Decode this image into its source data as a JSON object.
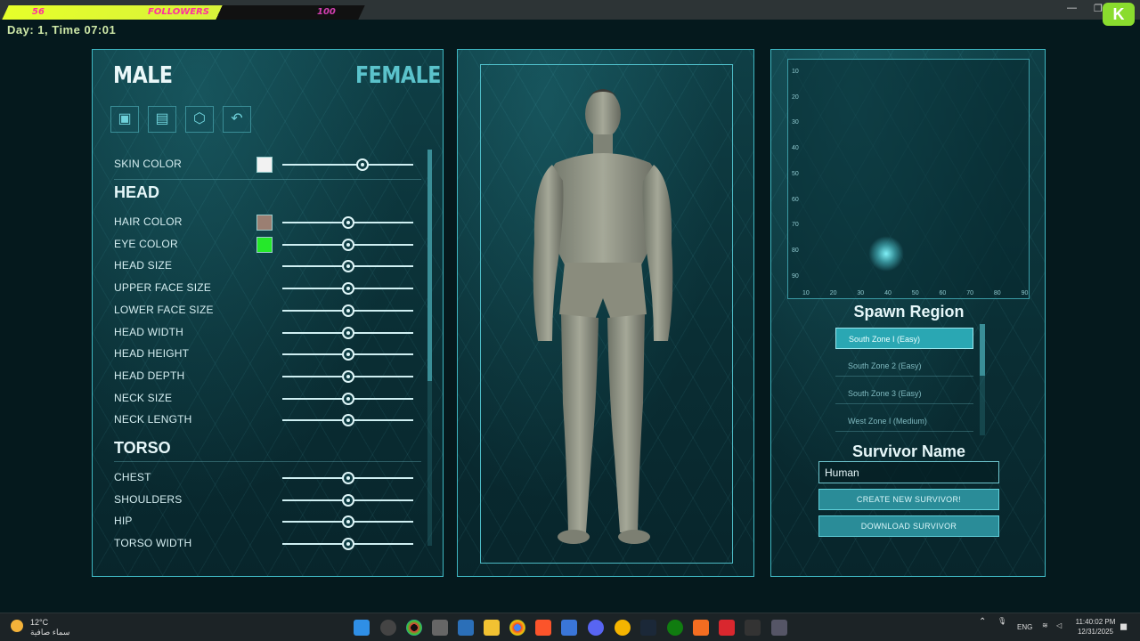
{
  "overlay": {
    "count_left": "56",
    "label": "FOLLOWERS",
    "count_right": "100"
  },
  "hud": {
    "day_time": "Day:  1,  Time  07:01"
  },
  "gender": {
    "male": "MALE",
    "female": "FEMALE"
  },
  "toolbar": {
    "icons": [
      "save-icon",
      "load-icon",
      "randomize-icon",
      "undo-icon"
    ]
  },
  "appearance": {
    "skin_color": {
      "label": "SKIN COLOR",
      "swatch": "#f2f2f2",
      "value": 0.61
    },
    "head_section": "HEAD",
    "head_rows": [
      {
        "label": "HAIR COLOR",
        "swatch": "#9b7f72",
        "value": 0.5
      },
      {
        "label": "EYE COLOR",
        "swatch": "#25e82a",
        "value": 0.5
      },
      {
        "label": "HEAD SIZE",
        "value": 0.5
      },
      {
        "label": "UPPER FACE SIZE",
        "value": 0.5
      },
      {
        "label": "LOWER FACE SIZE",
        "value": 0.5
      },
      {
        "label": "HEAD WIDTH",
        "value": 0.5
      },
      {
        "label": "HEAD HEIGHT",
        "value": 0.5
      },
      {
        "label": "HEAD DEPTH",
        "value": 0.5
      },
      {
        "label": "NECK SIZE",
        "value": 0.5
      },
      {
        "label": "NECK LENGTH",
        "value": 0.5
      }
    ],
    "torso_section": "TORSO",
    "torso_rows": [
      {
        "label": "CHEST",
        "value": 0.5
      },
      {
        "label": "SHOULDERS",
        "value": 0.5
      },
      {
        "label": "HIP",
        "value": 0.5
      },
      {
        "label": "TORSO WIDTH",
        "value": 0.5
      }
    ]
  },
  "map": {
    "y_ticks": [
      "10",
      "20",
      "30",
      "40",
      "50",
      "60",
      "70",
      "80",
      "90"
    ],
    "x_ticks": [
      "10",
      "20",
      "30",
      "40",
      "50",
      "60",
      "70",
      "80",
      "90"
    ]
  },
  "spawn": {
    "title": "Spawn Region",
    "regions": [
      {
        "label": "South Zone I (Easy)",
        "selected": true
      },
      {
        "label": "South Zone 2 (Easy)",
        "selected": false
      },
      {
        "label": "South Zone 3 (Easy)",
        "selected": false
      },
      {
        "label": "West Zone I (Medium)",
        "selected": false
      }
    ]
  },
  "survivor": {
    "title": "Survivor Name",
    "name_value": "Human",
    "create_label": "CREATE NEW SURVIVOR!",
    "download_label": "DOWNLOAD SURVIVOR"
  },
  "taskbar": {
    "temp": "12°C",
    "weather_desc": "سماء صافية",
    "lang": "ENG",
    "time": "11:40:02 PM",
    "date": "12/31/2025"
  }
}
